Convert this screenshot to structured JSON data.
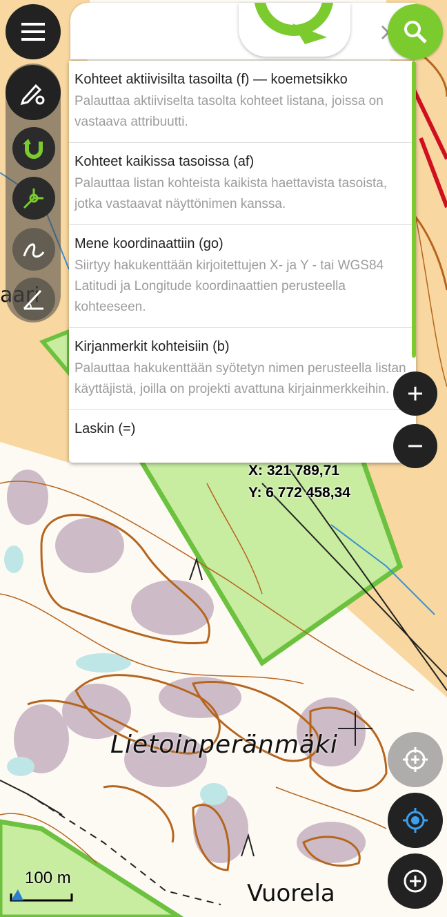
{
  "search": {
    "value": "",
    "placeholder": ""
  },
  "suggestions": [
    {
      "title": "Kohteet aktiivisilta tasoilta (f) — koemetsikko",
      "description": "Palauttaa aktiiviselta tasolta kohteet listana, joissa on vastaava attribuutti."
    },
    {
      "title": "Kohteet kaikissa tasoissa (af)",
      "description": "Palauttaa listan kohteista kaikista haettavista tasoista, jotka vastaavat näyttönimen kanssa."
    },
    {
      "title": "Mene koordinaattiin (go)",
      "description": "Siirtyy hakukenttään kirjoitettujen X- ja Y - tai WGS84 Latitudi ja Longitude koordinaattien perusteella kohteeseen."
    },
    {
      "title": "Kirjanmerkit kohteisiin (b)",
      "description": "Palauttaa hakukenttään syötetyn nimen perusteella listan käyttäjistä, joilla on projekti avattuna kirjainmerkkeihin."
    },
    {
      "title": "Laskin (=)",
      "description": ""
    }
  ],
  "map": {
    "coord_x": "X: 321 789,71",
    "coord_y": "Y: 6 772 458,34",
    "place_label_main": "Lietoinperänmäki",
    "place_label_bottom": "Vuorela",
    "place_label_left": "aari",
    "scale_label": "100 m"
  },
  "colors": {
    "accent": "#7bcb2f",
    "dark_button": "#222222",
    "polygon_fill": "#c8eca0",
    "polygon_stroke": "#6cc13f",
    "contour": "#b5651d",
    "field": "#f8d7a0"
  },
  "icons": [
    "menu-icon",
    "pencil-gear-icon",
    "magnet-icon",
    "vertex-icon",
    "freehand-icon",
    "measure-angle-icon",
    "clear-icon",
    "qr-code-icon",
    "search-icon",
    "crosshair-icon",
    "gps-locate-icon",
    "add-icon",
    "zoom-in-icon",
    "zoom-out-icon"
  ]
}
